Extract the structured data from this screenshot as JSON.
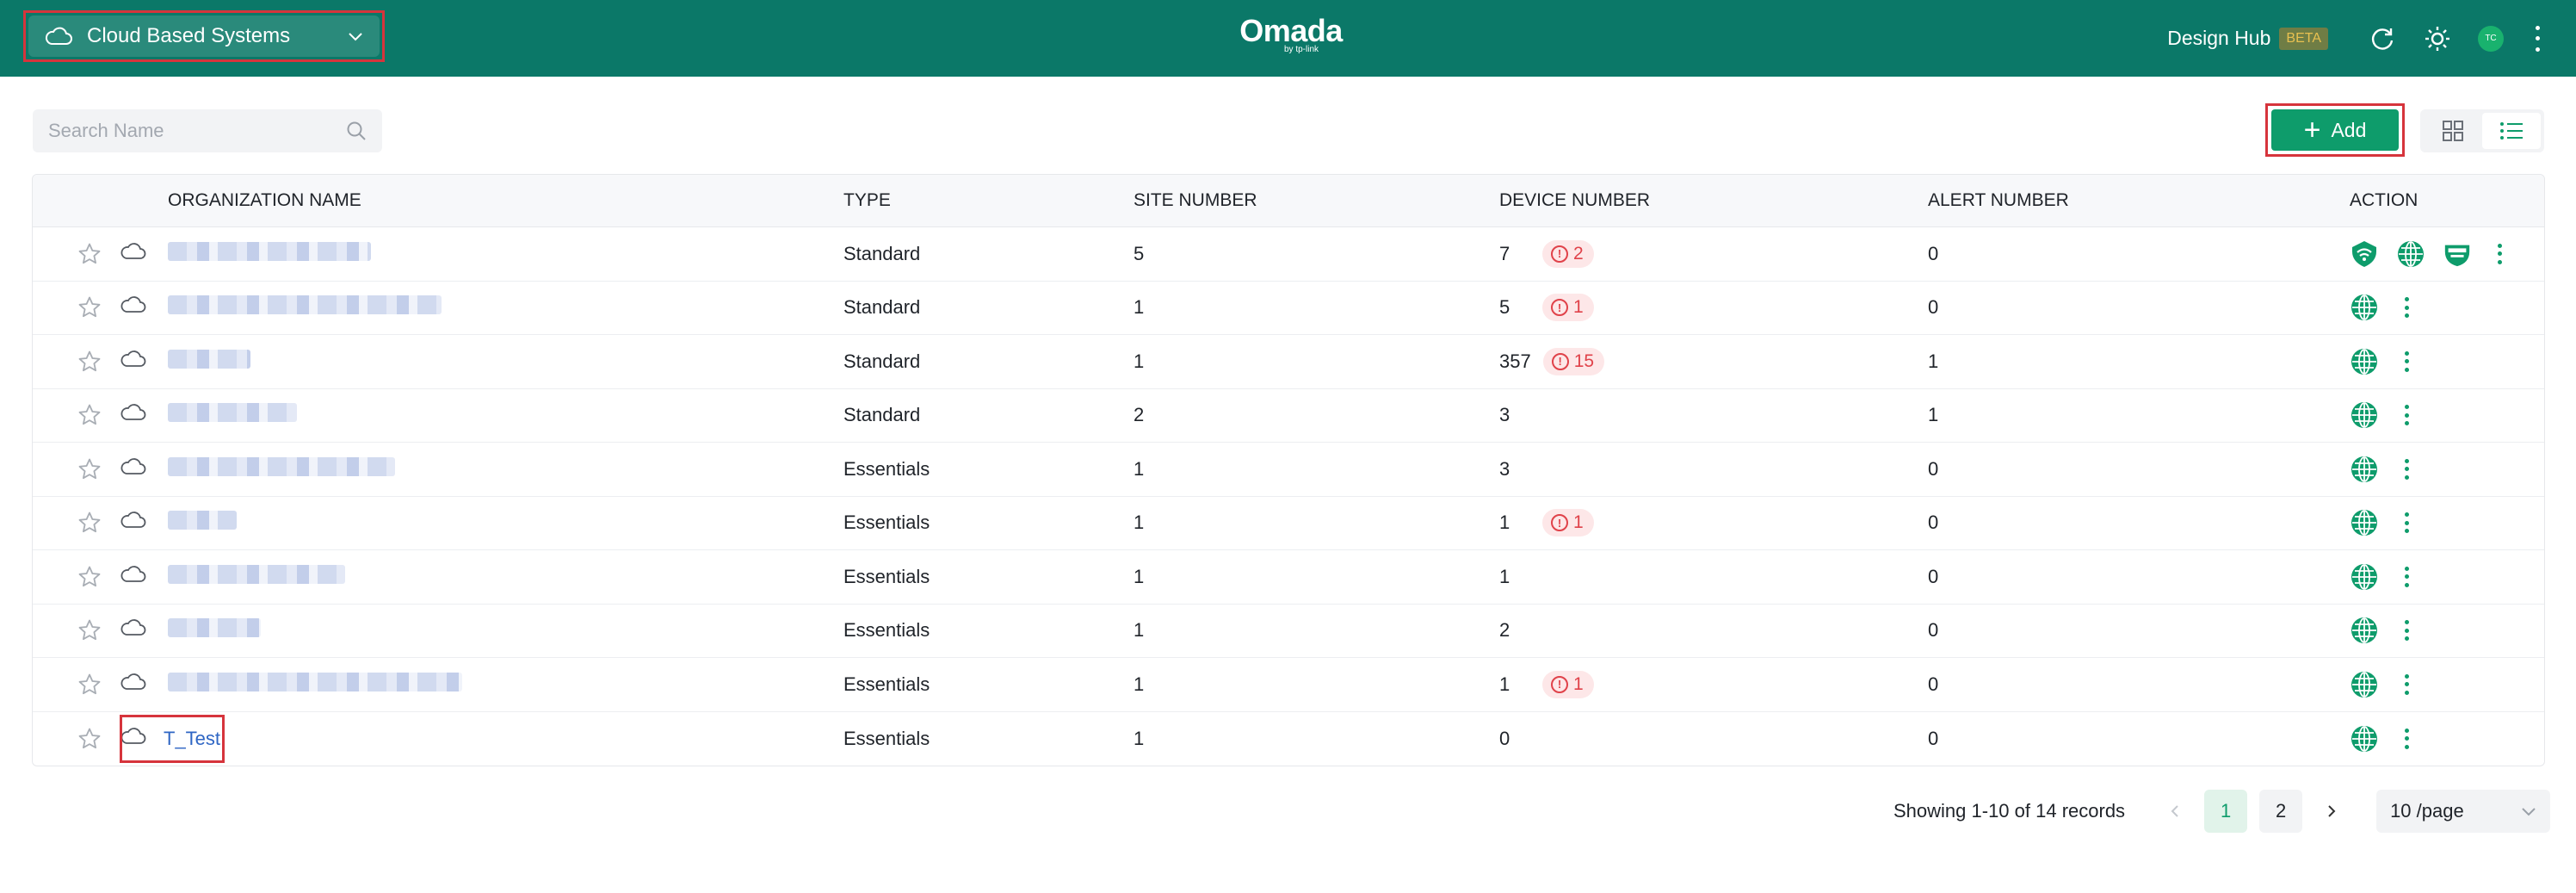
{
  "header": {
    "org_select": "Cloud Based Systems",
    "logo": "Omada",
    "logo_sub": "by tp-link",
    "design_hub": "Design Hub",
    "beta": "BETA",
    "avatar": "TC",
    "bg_color": "#0b7868"
  },
  "toolbar": {
    "search_placeholder": "Search Name",
    "add_label": "Add",
    "accent_color": "#0e9c6b"
  },
  "table": {
    "columns": [
      "ORGANIZATION NAME",
      "TYPE",
      "SITE NUMBER",
      "DEVICE NUMBER",
      "ALERT NUMBER",
      "ACTION"
    ],
    "rows": [
      {
        "name": "",
        "type": "Standard",
        "sites": "5",
        "devices": "7",
        "dev_alerts": "2",
        "alerts": "0",
        "actions": [
          "wifi-icon",
          "globe-icon",
          "switch-icon",
          "more-icon"
        ]
      },
      {
        "name": "",
        "type": "Standard",
        "sites": "1",
        "devices": "5",
        "dev_alerts": "1",
        "alerts": "0",
        "actions": [
          "globe-icon",
          "more-icon"
        ]
      },
      {
        "name": "",
        "type": "Standard",
        "sites": "1",
        "devices": "357",
        "dev_alerts": "15",
        "alerts": "1",
        "actions": [
          "globe-icon",
          "more-icon"
        ]
      },
      {
        "name": "",
        "type": "Standard",
        "sites": "2",
        "devices": "3",
        "dev_alerts": "",
        "alerts": "1",
        "actions": [
          "globe-icon",
          "more-icon"
        ]
      },
      {
        "name": "",
        "type": "Essentials",
        "sites": "1",
        "devices": "3",
        "dev_alerts": "",
        "alerts": "0",
        "actions": [
          "globe-icon",
          "more-icon"
        ]
      },
      {
        "name": "",
        "type": "Essentials",
        "sites": "1",
        "devices": "1",
        "dev_alerts": "1",
        "alerts": "0",
        "actions": [
          "globe-icon",
          "more-icon"
        ]
      },
      {
        "name": "",
        "type": "Essentials",
        "sites": "1",
        "devices": "1",
        "dev_alerts": "",
        "alerts": "0",
        "actions": [
          "globe-icon",
          "more-icon"
        ]
      },
      {
        "name": "",
        "type": "Essentials",
        "sites": "1",
        "devices": "2",
        "dev_alerts": "",
        "alerts": "0",
        "actions": [
          "globe-icon",
          "more-icon"
        ]
      },
      {
        "name": "",
        "type": "Essentials",
        "sites": "1",
        "devices": "1",
        "dev_alerts": "1",
        "alerts": "0",
        "actions": [
          "globe-icon",
          "more-icon"
        ]
      },
      {
        "name": "T_Test",
        "type": "Essentials",
        "sites": "1",
        "devices": "0",
        "dev_alerts": "",
        "alerts": "0",
        "actions": [
          "globe-icon",
          "more-icon"
        ]
      }
    ]
  },
  "pagination": {
    "info": "Showing 1-10 of 14 records",
    "pages": [
      "1",
      "2"
    ],
    "current_page": "1",
    "page_size": "10 /page"
  }
}
